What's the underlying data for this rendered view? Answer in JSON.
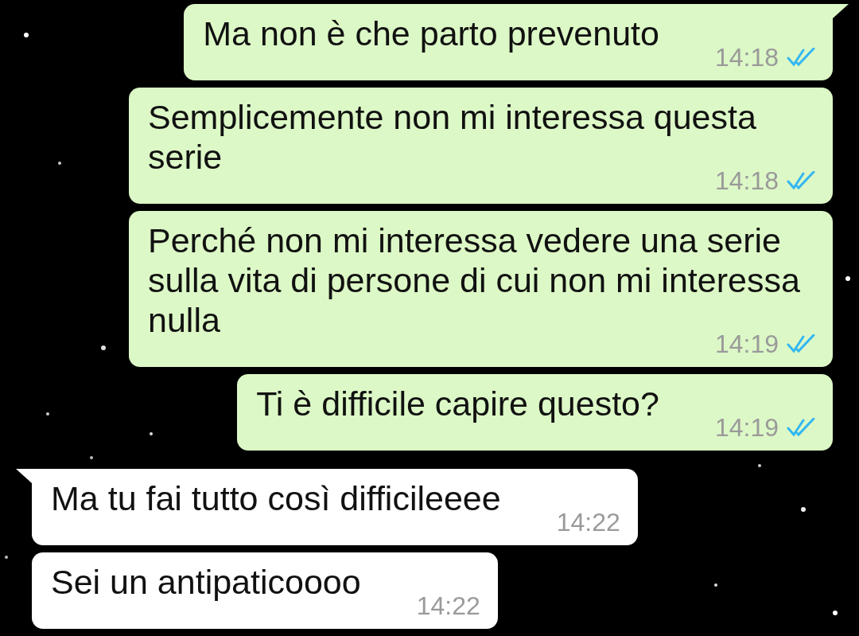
{
  "messages": [
    {
      "kind": "outgoing",
      "tail": true,
      "text": "Ma non è che parto prevenuto",
      "time": "14:18",
      "read": true
    },
    {
      "kind": "outgoing",
      "tail": false,
      "text": "Semplicemente non mi interessa questa serie",
      "time": "14:18",
      "read": true
    },
    {
      "kind": "outgoing",
      "tail": false,
      "text": "Perché non mi interessa vedere una serie sulla vita di persone di cui non mi interessa nulla",
      "time": "14:19",
      "read": true
    },
    {
      "kind": "outgoing",
      "tail": false,
      "text": "Ti è difficile capire questo?",
      "time": "14:19",
      "read": true
    },
    {
      "kind": "incoming",
      "tail": true,
      "text": "Ma tu fai tutto così difficileeee",
      "time": "14:22"
    },
    {
      "kind": "incoming",
      "tail": false,
      "text": "Sei un antipaticoooo",
      "time": "14:22"
    }
  ]
}
